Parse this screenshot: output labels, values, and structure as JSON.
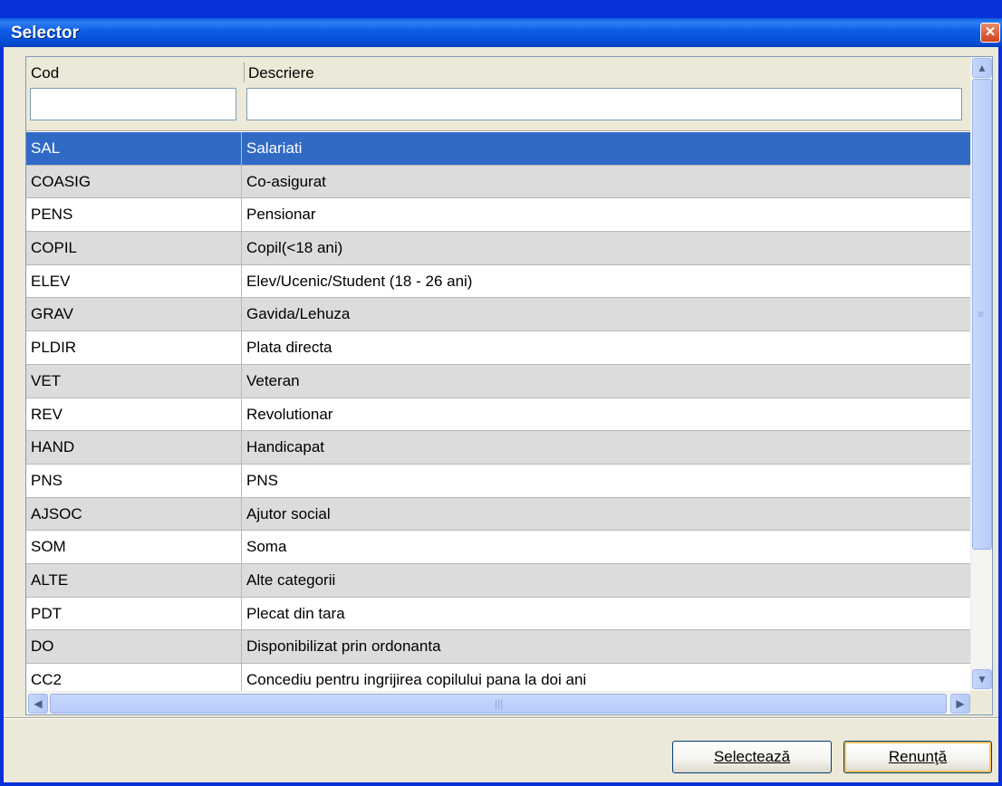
{
  "window": {
    "title": "Selector"
  },
  "grid": {
    "columns": [
      "Cod",
      "Descriere"
    ],
    "filters": {
      "cod": "",
      "descriere": ""
    },
    "rows": [
      {
        "cod": "SAL",
        "descriere": "Salariati"
      },
      {
        "cod": "COASIG",
        "descriere": "Co-asigurat"
      },
      {
        "cod": "PENS",
        "descriere": "Pensionar"
      },
      {
        "cod": "COPIL",
        "descriere": "Copil(<18 ani)"
      },
      {
        "cod": "ELEV",
        "descriere": "Elev/Ucenic/Student (18 - 26 ani)"
      },
      {
        "cod": "GRAV",
        "descriere": "Gavida/Lehuza"
      },
      {
        "cod": "PLDIR",
        "descriere": "Plata directa"
      },
      {
        "cod": "VET",
        "descriere": "Veteran"
      },
      {
        "cod": "REV",
        "descriere": "Revolutionar"
      },
      {
        "cod": "HAND",
        "descriere": "Handicapat"
      },
      {
        "cod": "PNS",
        "descriere": "PNS"
      },
      {
        "cod": "AJSOC",
        "descriere": "Ajutor social"
      },
      {
        "cod": "SOM",
        "descriere": "Soma"
      },
      {
        "cod": "ALTE",
        "descriere": "Alte categorii"
      },
      {
        "cod": "PDT",
        "descriere": "Plecat din tara"
      },
      {
        "cod": "DO",
        "descriere": "Disponibilizat prin ordonanta"
      },
      {
        "cod": "CC2",
        "descriere": "Concediu pentru ingrijirea copilului pana la doi ani"
      }
    ],
    "selected_index": 0
  },
  "buttons": {
    "select_label": "Selectează",
    "cancel_label": "Renunţă"
  },
  "icons": {
    "close": "close-icon",
    "scroll_up": "arrow-up-icon",
    "scroll_down": "arrow-down-icon",
    "scroll_left": "arrow-left-icon",
    "scroll_right": "arrow-right-icon"
  },
  "colors": {
    "titlebar": "#0550d6",
    "selection": "#316ac5",
    "row_alt": "#dcdcdc",
    "dialog_bg": "#ece9d8"
  }
}
